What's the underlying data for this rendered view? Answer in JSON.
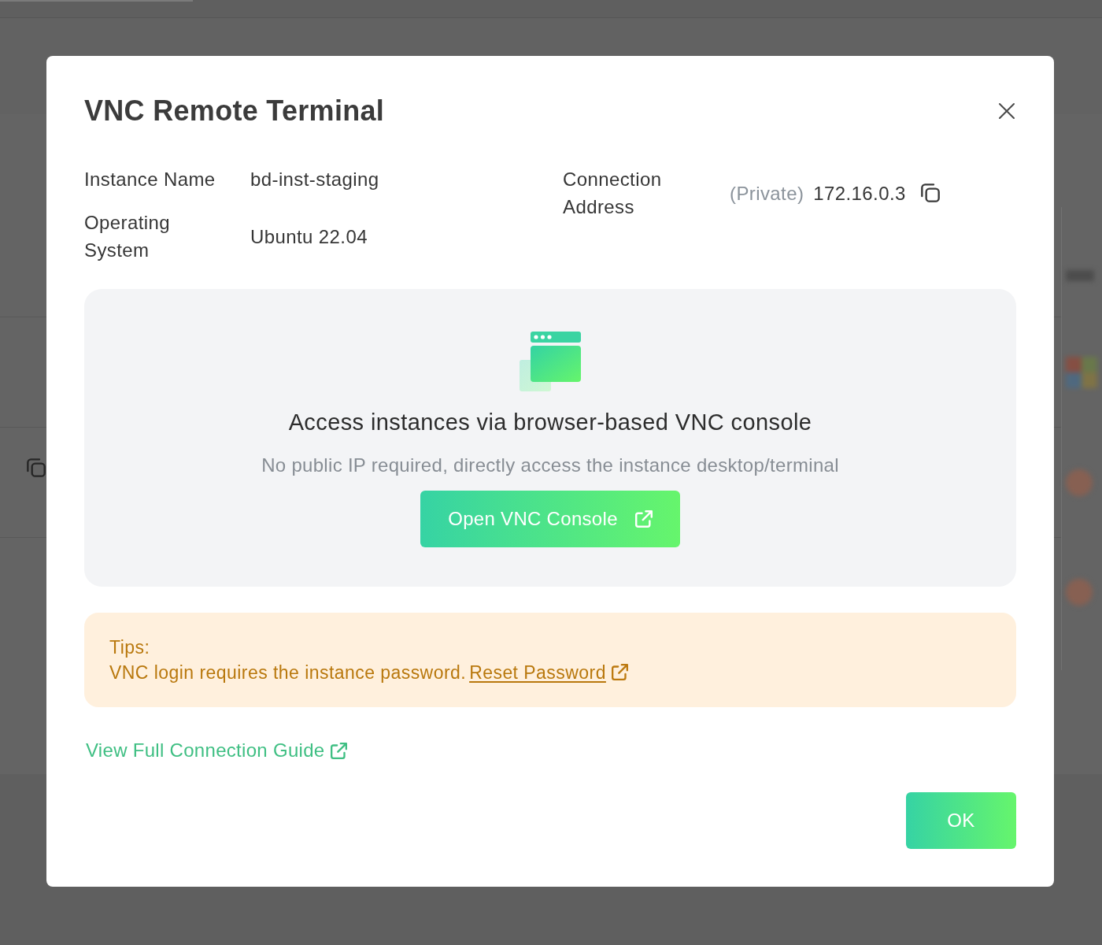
{
  "dialog": {
    "title": "VNC Remote Terminal"
  },
  "details": [
    {
      "items": [
        {
          "label": "Instance Name",
          "value": "bd-inst-staging",
          "copyable": false
        },
        {
          "label": "Operating System",
          "value": "Ubuntu 22.04",
          "copyable": false
        }
      ]
    },
    {
      "items": [
        {
          "label": "Connection Address",
          "note": "(Private)",
          "value": "172.16.0.3",
          "copyable": true
        }
      ]
    }
  ],
  "console": {
    "heading": "Access instances via browser-based VNC console",
    "description": "No public IP required, directly access the instance desktop/terminal",
    "button": "Open VNC Console"
  },
  "tips": {
    "title": "Tips:",
    "text": "VNC login requires the instance password.",
    "link": "Reset Password"
  },
  "guide_link": "View Full Connection Guide",
  "footer_buttons": [
    "OK"
  ]
}
